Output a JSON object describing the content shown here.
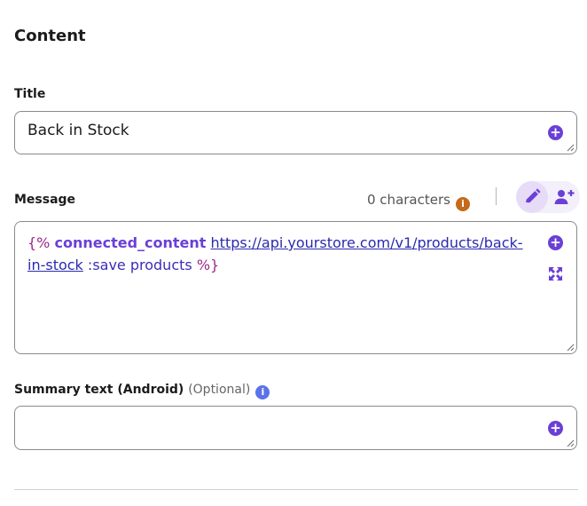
{
  "content": {
    "heading": "Content",
    "title_field": {
      "label": "Title",
      "value": "Back in Stock"
    },
    "message_field": {
      "label": "Message",
      "char_count_label": "0 characters",
      "tokens": {
        "open": "{%",
        "keyword": "connected_content",
        "url": "https://api.yourstore.com/v1/products/back-in-stock",
        "rest": ":save products",
        "close": "%}"
      }
    },
    "summary_field": {
      "label": "Summary text (Android)",
      "optional": "(Optional)",
      "value": ""
    }
  },
  "icons": {
    "add": "plus-circle-icon",
    "info": "info-icon",
    "edit": "pencil-icon",
    "personalize": "user-plus-icon",
    "expand": "expand-arrows-icon",
    "resize": "resize-grip-icon"
  },
  "colors": {
    "accent": "#6b3fd6",
    "info_orange": "#c56a1a",
    "info_blue": "#5b73e8",
    "liquid_brace": "#a0268a",
    "liquid_text": "#3a2db8"
  }
}
